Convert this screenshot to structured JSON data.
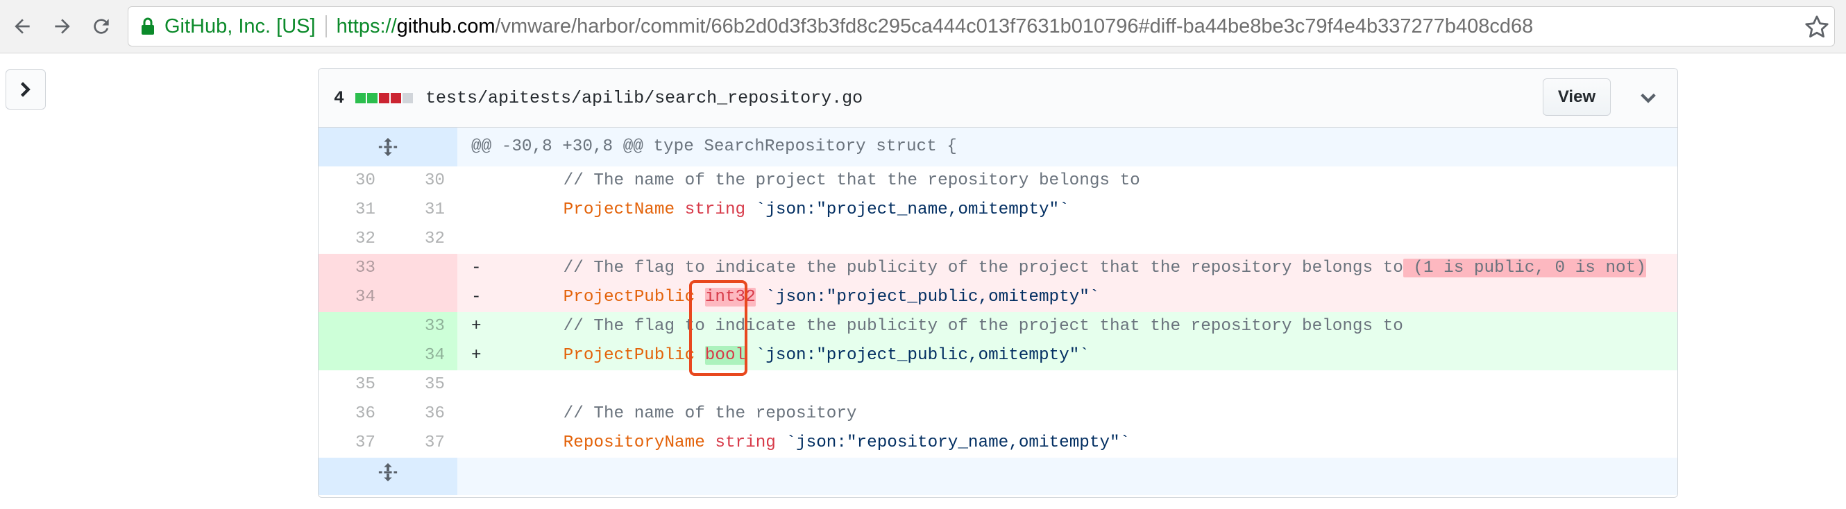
{
  "browser": {
    "identity": "GitHub, Inc. [US]",
    "url_scheme": "https://",
    "url_host": "github.com",
    "url_rest": "/vmware/harbor/commit/66b2d0d3f3b3fd8c295ca444c013f7631b010796#diff-ba44be8be3c79f4e4b337277b408cd68"
  },
  "file": {
    "changes": "4",
    "path": "tests/apitests/apilib/search_repository.go",
    "view_label": "View",
    "diffstat_colors": [
      "#2cbe4e",
      "#2cbe4e",
      "#cb2431",
      "#cb2431",
      "#d1d5da"
    ]
  },
  "diff": {
    "hunk_header": "@@ -30,8 +30,8 @@ type SearchRepository struct {",
    "lines": [
      {
        "old": "30",
        "new": "30",
        "marker": "",
        "type": "ctx"
      },
      {
        "old": "31",
        "new": "31",
        "marker": "",
        "type": "ctx"
      },
      {
        "old": "32",
        "new": "32",
        "marker": "",
        "type": "ctx"
      },
      {
        "old": "33",
        "new": "",
        "marker": "-",
        "type": "del"
      },
      {
        "old": "34",
        "new": "",
        "marker": "-",
        "type": "del"
      },
      {
        "old": "",
        "new": "33",
        "marker": "+",
        "type": "add"
      },
      {
        "old": "",
        "new": "34",
        "marker": "+",
        "type": "add"
      },
      {
        "old": "35",
        "new": "35",
        "marker": "",
        "type": "ctx"
      },
      {
        "old": "36",
        "new": "36",
        "marker": "",
        "type": "ctx"
      },
      {
        "old": "37",
        "new": "37",
        "marker": "",
        "type": "ctx"
      }
    ],
    "code": {
      "l30": "// The name of the project that the repository belongs to",
      "l31_field": "ProjectName",
      "l31_type": "string",
      "l31_tag": "`json:\"project_name,omitempty\"`",
      "l33_comment": "// The flag to indicate the publicity of the project that the repository belongs to",
      "l33_removed": " (1 is public, 0 is not)",
      "l34_field": "ProjectPublic",
      "l34_type": "int32",
      "l34_tag": "`json:\"project_public,omitempty\"`",
      "n33_comment": "// The flag to indicate the publicity of the project that the repository belongs to",
      "n34_field": "ProjectPublic",
      "n34_type": "bool",
      "n34_tag": "`json:\"project_public,omitempty\"`",
      "l36": "// The name of the repository",
      "l37_field": "RepositoryName",
      "l37_type": "string",
      "l37_tag": "`json:\"repository_name,omitempty\"`"
    }
  }
}
